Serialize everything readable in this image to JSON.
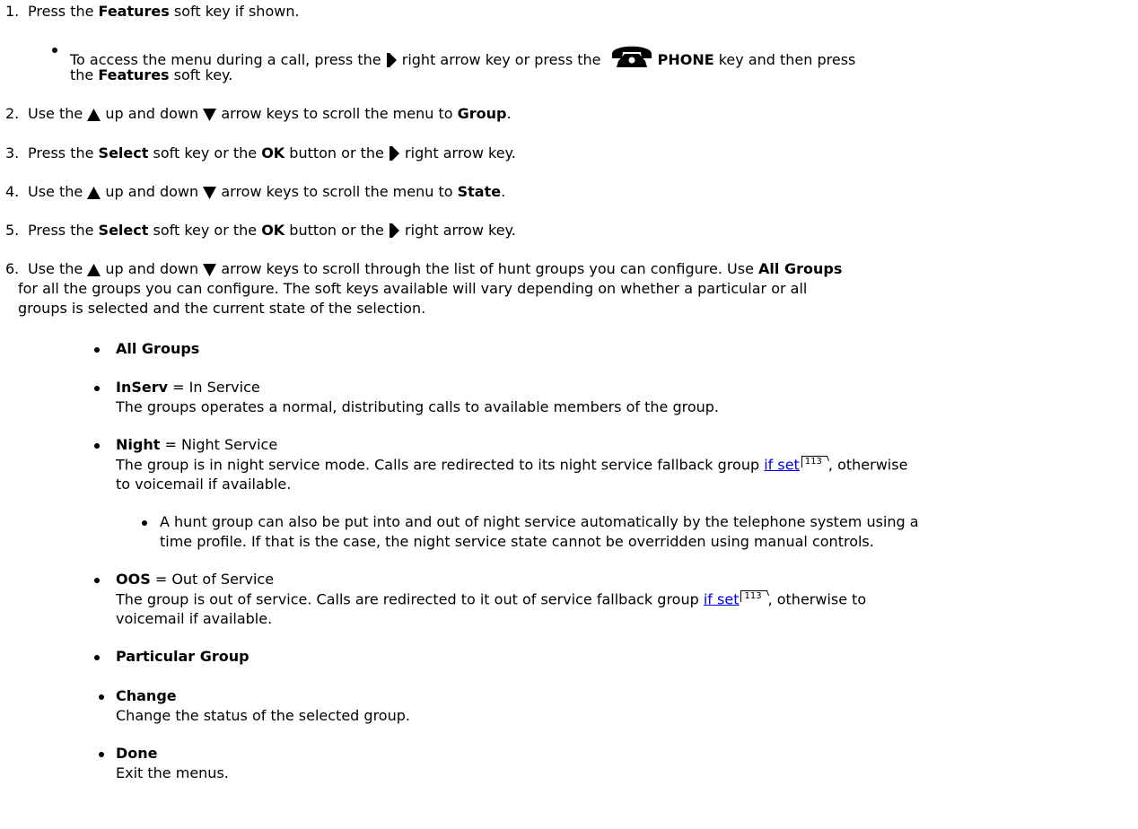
{
  "steps": [
    {
      "num": "1.",
      "text": [
        "Press the ",
        "Features",
        " soft key if shown."
      ]
    },
    {
      "num": "2.",
      "text": [
        "Use the ",
        " up and down ",
        " arrow keys to scroll the menu to ",
        "Group",
        "."
      ]
    },
    {
      "num": "3.",
      "text": [
        "Press the ",
        "Select",
        " soft key or the ",
        "OK",
        " button or the ",
        " right arrow key."
      ]
    },
    {
      "num": "4.",
      "text": [
        "Use the ",
        " up and down ",
        " arrow keys to scroll the menu to ",
        "State",
        "."
      ]
    },
    {
      "num": "5.",
      "text": [
        "Press the ",
        "Select",
        " soft key or the ",
        "OK",
        " button or the ",
        " right arrow key."
      ]
    },
    {
      "num": "6.",
      "line1": [
        "Use the ",
        " up and down ",
        " arrow keys to scroll through the list of hunt groups you can configure. Use ",
        "All Groups"
      ],
      "line2": "for all the groups you can configure. The soft keys available will vary depending on whether a particular or all",
      "line3": "groups is selected and the current state of the selection."
    }
  ],
  "step1_sub": {
    "line1": [
      "To access the menu during a call, press the ",
      " right arrow key or press the ",
      "PHONE",
      " key and then press"
    ],
    "line2": [
      "the ",
      "Features",
      " soft key."
    ]
  },
  "groups": {
    "all_groups": "All Groups",
    "inserv": {
      "term": "InServ",
      "def": " = In Service",
      "desc": "The groups operates a normal, distributing calls to available members of the group."
    },
    "night": {
      "term": "Night",
      "def": " = Night Service",
      "desc1": "The group is in night service mode. Calls are redirected to its night service fallback group ",
      "desc1_end": ", otherwise",
      "desc2": "to voicemail if available.",
      "sub1": "A hunt group can also be put into and out of night service automatically by the telephone system using a",
      "sub2": "time profile. If that is the case, the night service state cannot be overridden using manual controls."
    },
    "oos": {
      "term": "OOS",
      "def": " = Out of Service",
      "desc1": "The group is out of service. Calls are redirected to it out of service fallback group ",
      "desc1_end": ", otherwise to",
      "desc2": "voicemail if available."
    },
    "link_text": "if set",
    "page_ref": "113",
    "particular": "Particular Group",
    "change": {
      "term": "Change",
      "desc": "Change the status of the selected group."
    },
    "done": {
      "term": "Done",
      "desc": "Exit the menus."
    }
  },
  "icons": [
    "right-arrow-icon",
    "up-arrow-icon",
    "down-arrow-icon",
    "phone-icon"
  ]
}
